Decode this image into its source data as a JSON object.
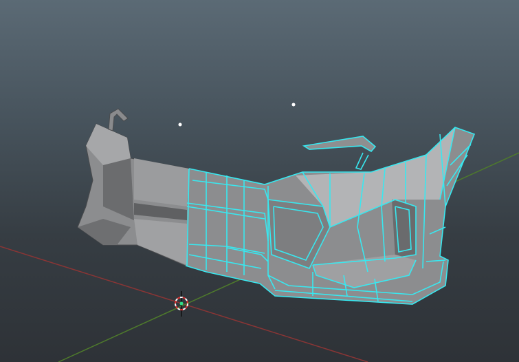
{
  "viewport": {
    "mode": "3d-edit-mesh",
    "colors": {
      "x_axis": "#8a3535",
      "y_axis": "#4e7a2c",
      "mesh_fill": "#8e8f90",
      "mesh_dark": "#5c5d5f",
      "selection": "#38e8f0",
      "cursor_red": "#e03030",
      "cursor_white": "#ffffff"
    },
    "icons": [
      "3d-cursor-icon",
      "light-icon",
      "empty-icon"
    ]
  }
}
